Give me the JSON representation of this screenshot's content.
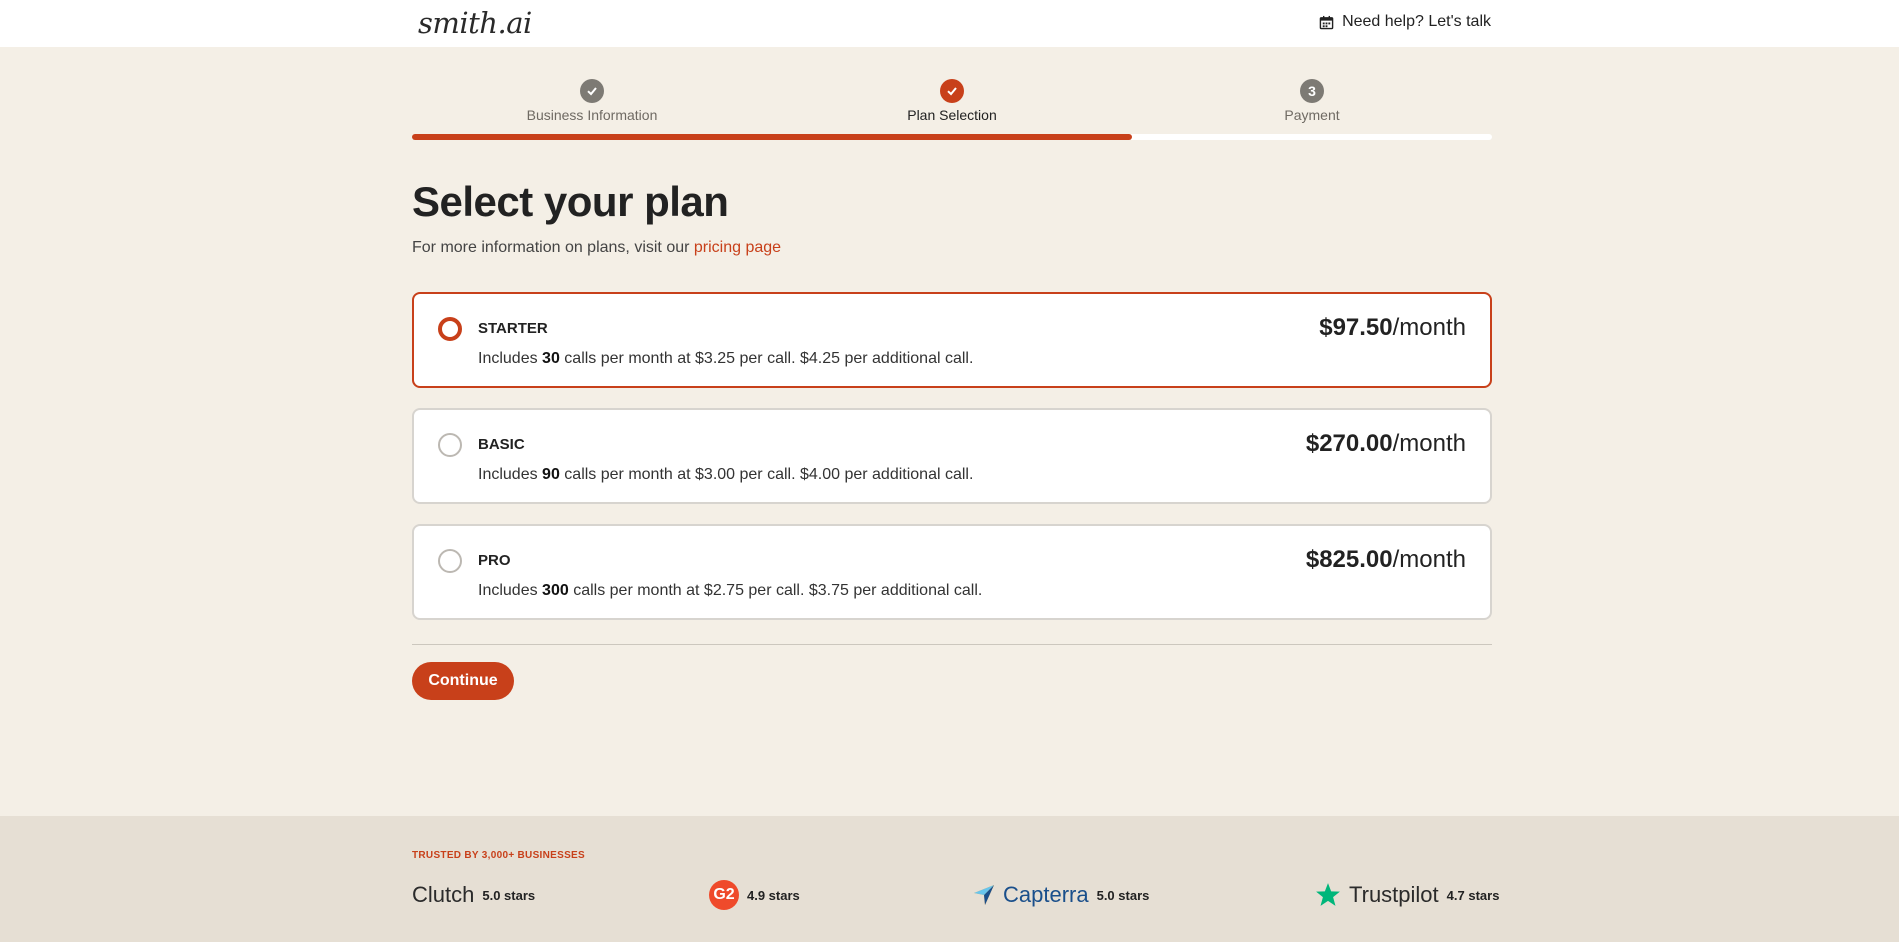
{
  "header": {
    "logo": "smith.ai",
    "help_label": "Need help? Let's talk"
  },
  "steps": [
    {
      "label": "Business Information",
      "status": "completed",
      "icon": "check-icon"
    },
    {
      "label": "Plan Selection",
      "status": "active",
      "icon": "check-icon"
    },
    {
      "label": "Payment",
      "status": "pending",
      "number": "3"
    }
  ],
  "progress": {
    "completed_fraction": 0.667
  },
  "page": {
    "title": "Select your plan",
    "subtitle_prefix": "For more information on plans, visit our ",
    "subtitle_link": "pricing page"
  },
  "plans": [
    {
      "name": "STARTER",
      "selected": true,
      "desc_prefix": "Includes ",
      "calls": "30",
      "desc_suffix": " calls per month at $3.25 per call. $4.25 per additional call.",
      "price": "$97.50",
      "per": "/month"
    },
    {
      "name": "BASIC",
      "selected": false,
      "desc_prefix": "Includes ",
      "calls": "90",
      "desc_suffix": " calls per month at $3.00 per call. $4.00 per additional call.",
      "price": "$270.00",
      "per": "/month"
    },
    {
      "name": "PRO",
      "selected": false,
      "desc_prefix": "Includes ",
      "calls": "300",
      "desc_suffix": " calls per month at $2.75 per call. $3.75 per additional call.",
      "price": "$825.00",
      "per": "/month"
    }
  ],
  "actions": {
    "continue_label": "Continue"
  },
  "footer": {
    "trusted": "TRUSTED BY 3,000+ BUSINESSES",
    "reviews": [
      {
        "brand": "Clutch",
        "rating": "5.0 stars"
      },
      {
        "brand": "G2",
        "rating": "4.9 stars"
      },
      {
        "brand": "Capterra",
        "rating": "5.0 stars"
      },
      {
        "brand": "Trustpilot",
        "rating": "4.7 stars"
      }
    ]
  },
  "colors": {
    "accent": "#c8401a",
    "background": "#f4efe6",
    "footer": "#e6dfd4",
    "step_done": "#7d7a74"
  }
}
